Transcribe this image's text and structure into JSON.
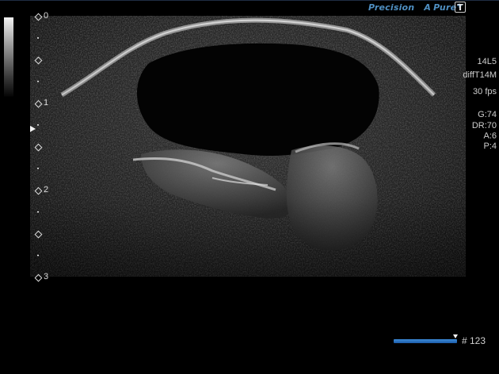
{
  "header": {
    "precision_label": "Precision",
    "apure_label": "A",
    "apure_word": "Pure",
    "apure_plus": "+",
    "t_button": "T"
  },
  "depth_labels": [
    "0",
    "1",
    "2",
    "3"
  ],
  "parameters": {
    "probe": "14L5",
    "mode": "diffT14M",
    "frame_rate": "30 fps",
    "gain": "G:74",
    "dynamic_range": "DR:70",
    "a_value": "A:6",
    "p_value": "P:4"
  },
  "cine": {
    "frame_label": "# 123",
    "position": 0.97
  },
  "colors": {
    "brand": "#4f8fc2",
    "cine_bar": "#2f7ad0",
    "text": "#cfcfcf"
  },
  "icons": {
    "focus_marker": "focus-arrow-icon",
    "depth_marker": "diamond-icon"
  }
}
